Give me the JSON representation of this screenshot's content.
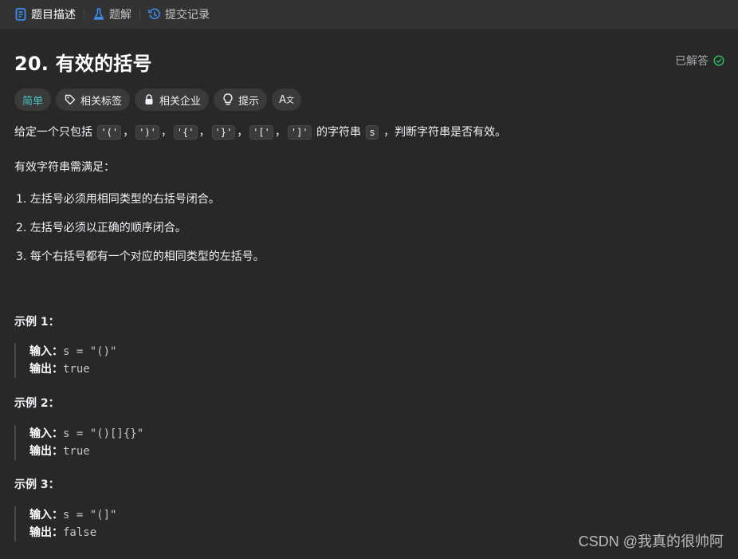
{
  "tabs": [
    {
      "label": "题目描述",
      "icon": "description-icon",
      "active": true
    },
    {
      "label": "题解",
      "icon": "flask-icon",
      "active": false
    },
    {
      "label": "提交记录",
      "icon": "history-icon",
      "active": false
    }
  ],
  "problem": {
    "title": "20. 有效的括号",
    "status": "已解答",
    "tags": {
      "difficulty": "简单",
      "related_tags": "相关标签",
      "companies": "相关企业",
      "hint": "提示",
      "translate": "A"
    }
  },
  "description": {
    "intro_prefix": "给定一个只包括 ",
    "chars": [
      "'('",
      "')'",
      "'{'",
      "'}'",
      "'['",
      "']'"
    ],
    "sep": "，",
    "intro_mid": " 的字符串 ",
    "var": "s",
    "intro_suffix": " ，判断字符串是否有效。",
    "rule_title": "有效字符串需满足：",
    "rules": [
      "1. 左括号必须用相同类型的右括号闭合。",
      "2. 左括号必须以正确的顺序闭合。",
      "3. 每个右括号都有一个对应的相同类型的左括号。"
    ]
  },
  "examples": [
    {
      "title": "示例 1：",
      "input_label": "输入：",
      "input": "s = \"()\"",
      "output_label": "输出：",
      "output": "true"
    },
    {
      "title": "示例 2：",
      "input_label": "输入：",
      "input": "s = \"()[]{}\"",
      "output_label": "输出：",
      "output": "true"
    },
    {
      "title": "示例 3：",
      "input_label": "输入：",
      "input": "s = \"(]\"",
      "output_label": "输出：",
      "output": "false"
    }
  ],
  "watermark": "CSDN @我真的很帅阿",
  "colors": {
    "accent_easy": "#46c6c2",
    "solved": "#2cbb5d",
    "tab_icon_blue": "#3b8ced"
  }
}
